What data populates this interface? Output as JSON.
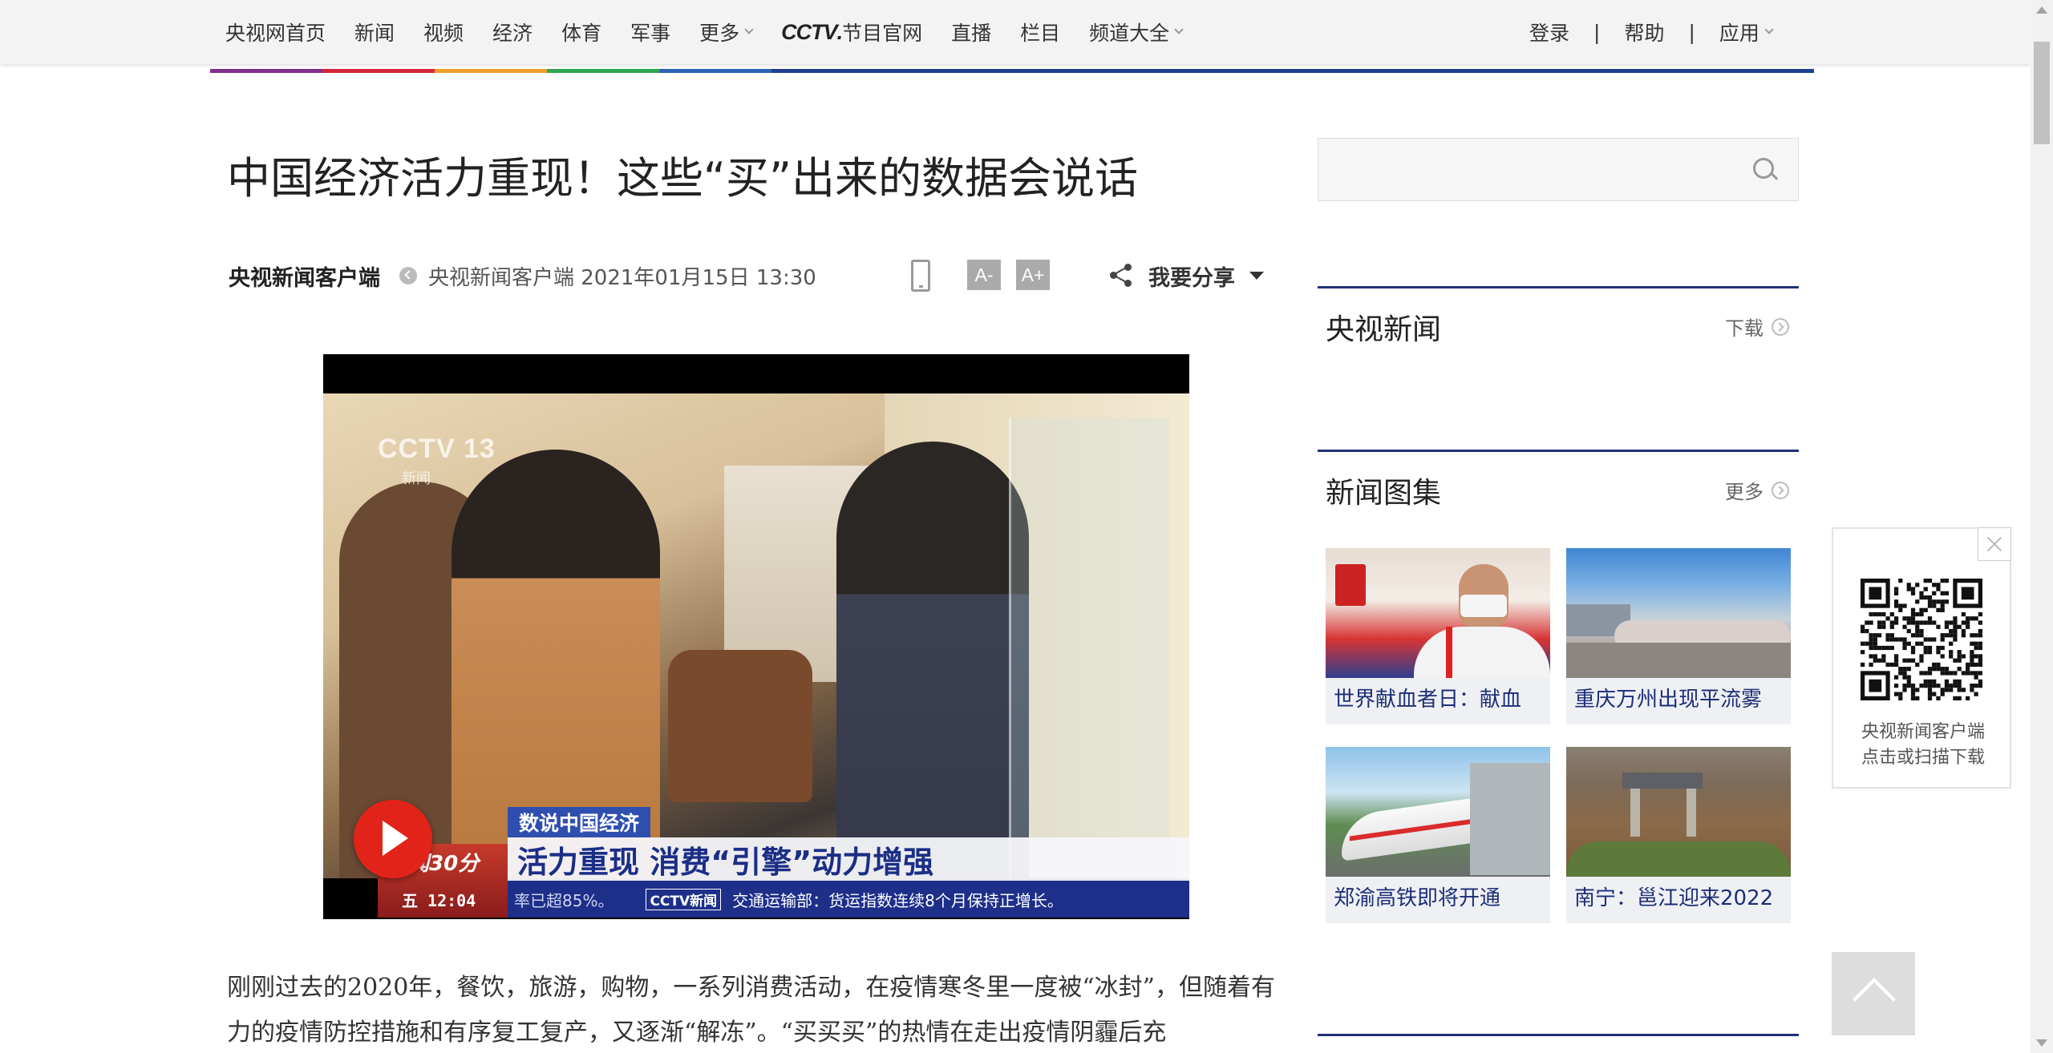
{
  "nav": {
    "left_items": [
      {
        "label": "央视网首页",
        "dropdown": false
      },
      {
        "label": "新闻",
        "dropdown": false
      },
      {
        "label": "视频",
        "dropdown": false
      },
      {
        "label": "经济",
        "dropdown": false
      },
      {
        "label": "体育",
        "dropdown": false
      },
      {
        "label": "军事",
        "dropdown": false
      },
      {
        "label": "更多",
        "dropdown": true
      }
    ],
    "cctv_logo": "CCTV",
    "official_label": "节目官网",
    "mid_items": [
      {
        "label": "直播",
        "dropdown": false
      },
      {
        "label": "栏目",
        "dropdown": false
      },
      {
        "label": "频道大全",
        "dropdown": true
      }
    ],
    "login": "登录",
    "help": "帮助",
    "apps": "应用",
    "separator": "|"
  },
  "article": {
    "title": "中国经济活力重现！这些“买”出来的数据会说话",
    "source": "央视新闻客户端",
    "meta_text": "央视新闻客户端 2021年01月15日 13:30",
    "font_small": "A-",
    "font_large": "A+",
    "share_label": "我要分享",
    "body": "刚刚过去的2020年，餐饮，旅游，购物，一系列消费活动，在疫情寒冬里一度被“冰封”，但随着有力的疫情防控措施和有序复工复产，又逐渐“解冻”。“买买买”的热情在走出疫情阴霾后充"
  },
  "video": {
    "watermark": "CCTV 13",
    "watermark_sub": "新闻",
    "tag": "数说中国经济",
    "headline": "活力重现 消费“引擎”动力增强",
    "ticker_prefix": "率已超85%。",
    "ticker_logo": "CCTV新闻",
    "ticker_text": "交通运输部：货运指数连续8个月保持正增长。",
    "program": "新闻30分",
    "program_time": "五 12:04"
  },
  "sidebar": {
    "search_placeholder": "",
    "cctv_news": {
      "title": "央视新闻",
      "more": "下载"
    },
    "gallery": {
      "title": "新闻图集",
      "more": "更多",
      "items": [
        {
          "caption": "世界献血者日：献血"
        },
        {
          "caption": "重庆万州出现平流雾"
        },
        {
          "caption": "郑渝高铁即将开通"
        },
        {
          "caption": "南宁：邕江迎来2022"
        }
      ]
    },
    "qr": {
      "line1": "央视新闻客户端",
      "line2": "点击或扫描下载"
    }
  },
  "colors": {
    "rainbow": [
      "#7e2f8e",
      "#d6263a",
      "#f0a030",
      "#2fa84f",
      "#2b64b6",
      "#1f3f8f"
    ],
    "panel_border": "#1f3175",
    "caption": "#1c2e78",
    "play_button": "#e2231a"
  }
}
